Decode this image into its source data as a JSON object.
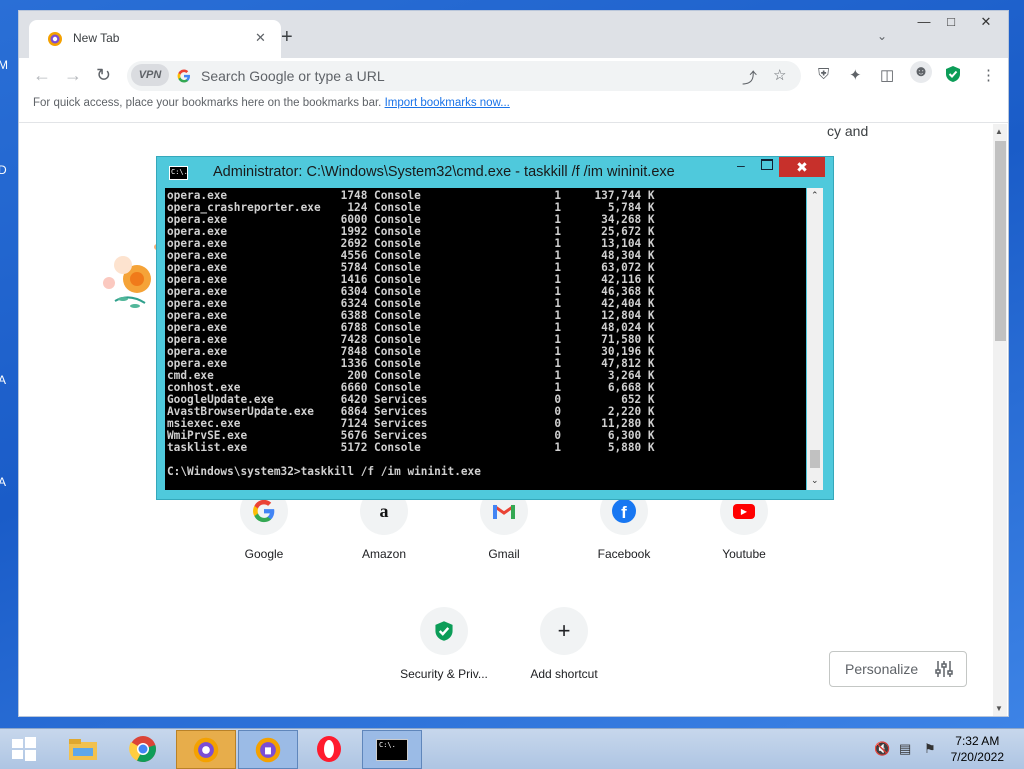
{
  "desktop": {
    "edge_letters": [
      "M",
      "D",
      "A",
      "A"
    ]
  },
  "browser": {
    "tab": {
      "title": "New Tab"
    },
    "omnibox": {
      "vpn_label": "VPN",
      "placeholder": "Search Google or type a URL"
    },
    "bookmarks_bar": {
      "text": "For quick access, place your bookmarks here on the bookmarks bar.",
      "link": "Import bookmarks now..."
    },
    "page": {
      "partial_text": "cy and",
      "shortcuts": [
        {
          "label": "Google",
          "icon": "google-icon"
        },
        {
          "label": "Amazon",
          "icon": "amazon-icon"
        },
        {
          "label": "Gmail",
          "icon": "gmail-icon"
        },
        {
          "label": "Facebook",
          "icon": "facebook-icon"
        },
        {
          "label": "Youtube",
          "icon": "youtube-icon"
        },
        {
          "label": "Security & Priv...",
          "icon": "shield-icon"
        },
        {
          "label": "Add shortcut",
          "icon": "plus-icon"
        }
      ],
      "personalize_label": "Personalize"
    }
  },
  "cmd": {
    "title": "Administrator: C:\\Windows\\System32\\cmd.exe - taskkill  /f /im wininit.exe",
    "icon_text": "C:\\.",
    "lines": [
      "opera.exe                 1748 Console                    1     137,744 K",
      "opera_crashreporter.exe    124 Console                    1       5,784 K",
      "opera.exe                 6000 Console                    1      34,268 K",
      "opera.exe                 1992 Console                    1      25,672 K",
      "opera.exe                 2692 Console                    1      13,104 K",
      "opera.exe                 4556 Console                    1      48,304 K",
      "opera.exe                 5784 Console                    1      63,072 K",
      "opera.exe                 1416 Console                    1      42,116 K",
      "opera.exe                 6304 Console                    1      46,368 K",
      "opera.exe                 6324 Console                    1      42,404 K",
      "opera.exe                 6388 Console                    1      12,804 K",
      "opera.exe                 6788 Console                    1      48,024 K",
      "opera.exe                 7428 Console                    1      71,580 K",
      "opera.exe                 7848 Console                    1      30,196 K",
      "opera.exe                 1336 Console                    1      47,812 K",
      "cmd.exe                    200 Console                    1       3,264 K",
      "conhost.exe               6660 Console                    1       6,668 K",
      "GoogleUpdate.exe          6420 Services                   0         652 K",
      "AvastBrowserUpdate.exe    6864 Services                   0       2,220 K",
      "msiexec.exe               7124 Services                   0      11,280 K",
      "WmiPrvSE.exe              5676 Services                   0       6,300 K",
      "tasklist.exe              5172 Console                    1       5,880 K",
      "",
      "C:\\Windows\\system32>taskkill /f /im wininit.exe"
    ]
  },
  "taskbar": {
    "items": [
      {
        "name": "file-explorer-icon"
      },
      {
        "name": "chrome-icon"
      },
      {
        "name": "avast-browser-icon"
      },
      {
        "name": "avast-secure-browser-icon"
      },
      {
        "name": "opera-icon"
      },
      {
        "name": "cmd-icon",
        "text": "C:\\."
      }
    ],
    "time": "7:32 AM",
    "date": "7/20/2022"
  }
}
